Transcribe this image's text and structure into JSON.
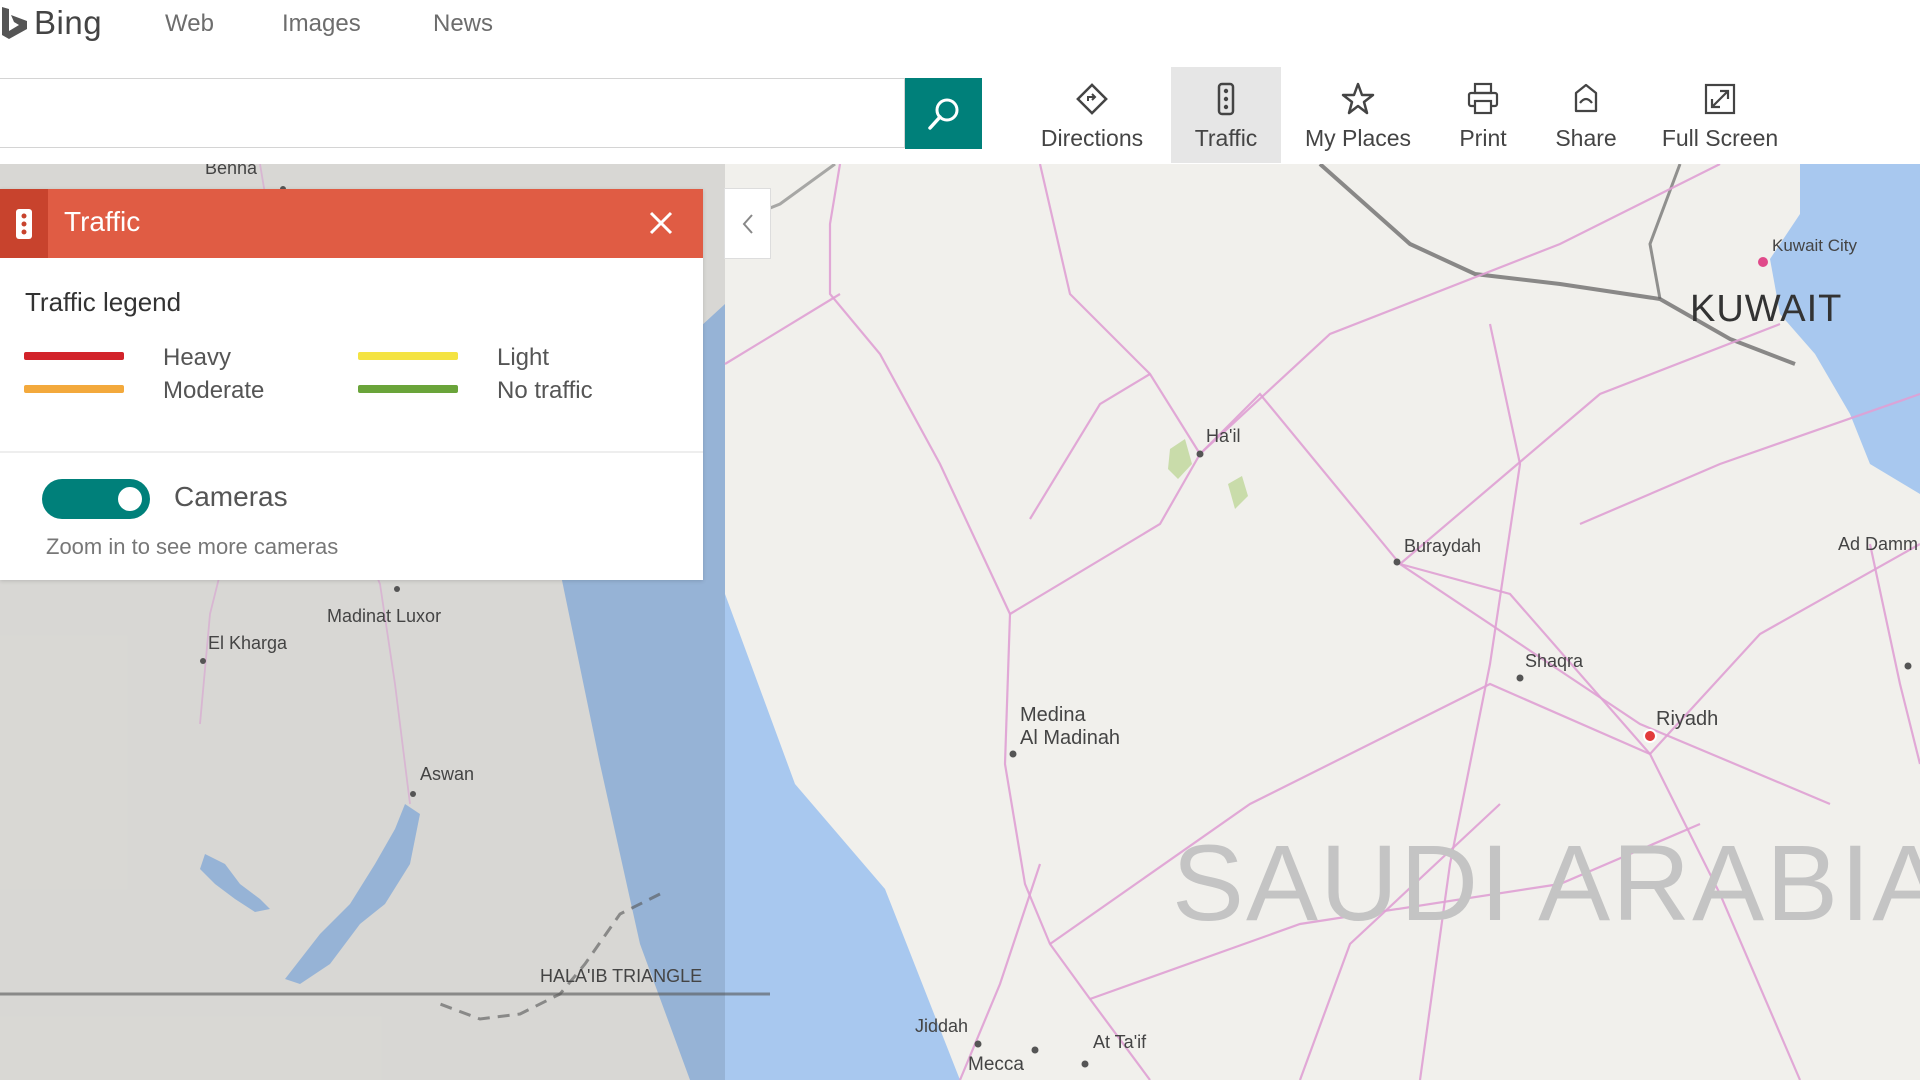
{
  "brand": {
    "name": "Bing"
  },
  "nav": {
    "links": [
      "Web",
      "Images",
      "News"
    ]
  },
  "search": {
    "value": "",
    "placeholder": ""
  },
  "toolbar": {
    "items": [
      {
        "label": "Directions",
        "icon": "directions-icon"
      },
      {
        "label": "Traffic",
        "icon": "traffic-icon",
        "active": true
      },
      {
        "label": "My Places",
        "icon": "star-icon"
      },
      {
        "label": "Print",
        "icon": "print-icon"
      },
      {
        "label": "Share",
        "icon": "share-icon"
      },
      {
        "label": "Full Screen",
        "icon": "full-screen-icon"
      }
    ]
  },
  "traffic_panel": {
    "title": "Traffic",
    "legend_title": "Traffic legend",
    "legend": [
      {
        "label": "Heavy",
        "color": "#d2232a"
      },
      {
        "label": "Light",
        "color": "#f4e342"
      },
      {
        "label": "Moderate",
        "color": "#f3a93c"
      },
      {
        "label": "No traffic",
        "color": "#6aa43a"
      }
    ],
    "cameras": {
      "label": "Cameras",
      "enabled": true,
      "hint": "Zoom in to see more cameras"
    }
  },
  "map": {
    "countries": [
      "KUWAIT",
      "SAUDI ARABIA"
    ],
    "cities": [
      "Benha",
      "Kuwait City",
      "Ha'il",
      "Buraydah",
      "Ad Damm",
      "Madinat Luxor",
      "El Kharga",
      "Shaqra",
      "Riyadh",
      "Medina",
      "Al Madinah",
      "Aswan",
      "HALA'IB TRIANGLE",
      "Jiddah",
      "Mecca",
      "At Ta'if"
    ]
  },
  "colors": {
    "accent": "#00807a",
    "traffic_header": "#e05c44",
    "water": "#a8c8ef",
    "land": "#f1f0ec"
  }
}
